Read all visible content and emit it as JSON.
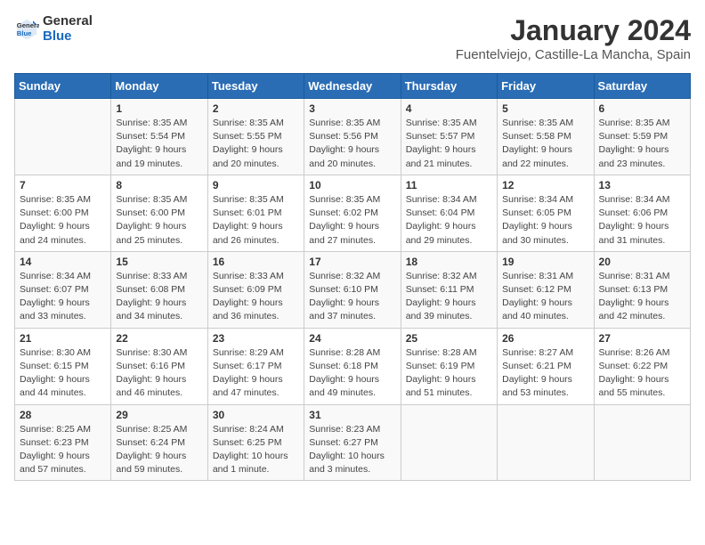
{
  "header": {
    "logo_line1": "General",
    "logo_line2": "Blue",
    "month": "January 2024",
    "location": "Fuentelviejo, Castille-La Mancha, Spain"
  },
  "weekdays": [
    "Sunday",
    "Monday",
    "Tuesday",
    "Wednesday",
    "Thursday",
    "Friday",
    "Saturday"
  ],
  "weeks": [
    [
      {
        "day": "",
        "info": ""
      },
      {
        "day": "1",
        "info": "Sunrise: 8:35 AM\nSunset: 5:54 PM\nDaylight: 9 hours\nand 19 minutes."
      },
      {
        "day": "2",
        "info": "Sunrise: 8:35 AM\nSunset: 5:55 PM\nDaylight: 9 hours\nand 20 minutes."
      },
      {
        "day": "3",
        "info": "Sunrise: 8:35 AM\nSunset: 5:56 PM\nDaylight: 9 hours\nand 20 minutes."
      },
      {
        "day": "4",
        "info": "Sunrise: 8:35 AM\nSunset: 5:57 PM\nDaylight: 9 hours\nand 21 minutes."
      },
      {
        "day": "5",
        "info": "Sunrise: 8:35 AM\nSunset: 5:58 PM\nDaylight: 9 hours\nand 22 minutes."
      },
      {
        "day": "6",
        "info": "Sunrise: 8:35 AM\nSunset: 5:59 PM\nDaylight: 9 hours\nand 23 minutes."
      }
    ],
    [
      {
        "day": "7",
        "info": "Sunrise: 8:35 AM\nSunset: 6:00 PM\nDaylight: 9 hours\nand 24 minutes."
      },
      {
        "day": "8",
        "info": "Sunrise: 8:35 AM\nSunset: 6:00 PM\nDaylight: 9 hours\nand 25 minutes."
      },
      {
        "day": "9",
        "info": "Sunrise: 8:35 AM\nSunset: 6:01 PM\nDaylight: 9 hours\nand 26 minutes."
      },
      {
        "day": "10",
        "info": "Sunrise: 8:35 AM\nSunset: 6:02 PM\nDaylight: 9 hours\nand 27 minutes."
      },
      {
        "day": "11",
        "info": "Sunrise: 8:34 AM\nSunset: 6:04 PM\nDaylight: 9 hours\nand 29 minutes."
      },
      {
        "day": "12",
        "info": "Sunrise: 8:34 AM\nSunset: 6:05 PM\nDaylight: 9 hours\nand 30 minutes."
      },
      {
        "day": "13",
        "info": "Sunrise: 8:34 AM\nSunset: 6:06 PM\nDaylight: 9 hours\nand 31 minutes."
      }
    ],
    [
      {
        "day": "14",
        "info": "Sunrise: 8:34 AM\nSunset: 6:07 PM\nDaylight: 9 hours\nand 33 minutes."
      },
      {
        "day": "15",
        "info": "Sunrise: 8:33 AM\nSunset: 6:08 PM\nDaylight: 9 hours\nand 34 minutes."
      },
      {
        "day": "16",
        "info": "Sunrise: 8:33 AM\nSunset: 6:09 PM\nDaylight: 9 hours\nand 36 minutes."
      },
      {
        "day": "17",
        "info": "Sunrise: 8:32 AM\nSunset: 6:10 PM\nDaylight: 9 hours\nand 37 minutes."
      },
      {
        "day": "18",
        "info": "Sunrise: 8:32 AM\nSunset: 6:11 PM\nDaylight: 9 hours\nand 39 minutes."
      },
      {
        "day": "19",
        "info": "Sunrise: 8:31 AM\nSunset: 6:12 PM\nDaylight: 9 hours\nand 40 minutes."
      },
      {
        "day": "20",
        "info": "Sunrise: 8:31 AM\nSunset: 6:13 PM\nDaylight: 9 hours\nand 42 minutes."
      }
    ],
    [
      {
        "day": "21",
        "info": "Sunrise: 8:30 AM\nSunset: 6:15 PM\nDaylight: 9 hours\nand 44 minutes."
      },
      {
        "day": "22",
        "info": "Sunrise: 8:30 AM\nSunset: 6:16 PM\nDaylight: 9 hours\nand 46 minutes."
      },
      {
        "day": "23",
        "info": "Sunrise: 8:29 AM\nSunset: 6:17 PM\nDaylight: 9 hours\nand 47 minutes."
      },
      {
        "day": "24",
        "info": "Sunrise: 8:28 AM\nSunset: 6:18 PM\nDaylight: 9 hours\nand 49 minutes."
      },
      {
        "day": "25",
        "info": "Sunrise: 8:28 AM\nSunset: 6:19 PM\nDaylight: 9 hours\nand 51 minutes."
      },
      {
        "day": "26",
        "info": "Sunrise: 8:27 AM\nSunset: 6:21 PM\nDaylight: 9 hours\nand 53 minutes."
      },
      {
        "day": "27",
        "info": "Sunrise: 8:26 AM\nSunset: 6:22 PM\nDaylight: 9 hours\nand 55 minutes."
      }
    ],
    [
      {
        "day": "28",
        "info": "Sunrise: 8:25 AM\nSunset: 6:23 PM\nDaylight: 9 hours\nand 57 minutes."
      },
      {
        "day": "29",
        "info": "Sunrise: 8:25 AM\nSunset: 6:24 PM\nDaylight: 9 hours\nand 59 minutes."
      },
      {
        "day": "30",
        "info": "Sunrise: 8:24 AM\nSunset: 6:25 PM\nDaylight: 10 hours\nand 1 minute."
      },
      {
        "day": "31",
        "info": "Sunrise: 8:23 AM\nSunset: 6:27 PM\nDaylight: 10 hours\nand 3 minutes."
      },
      {
        "day": "",
        "info": ""
      },
      {
        "day": "",
        "info": ""
      },
      {
        "day": "",
        "info": ""
      }
    ]
  ]
}
